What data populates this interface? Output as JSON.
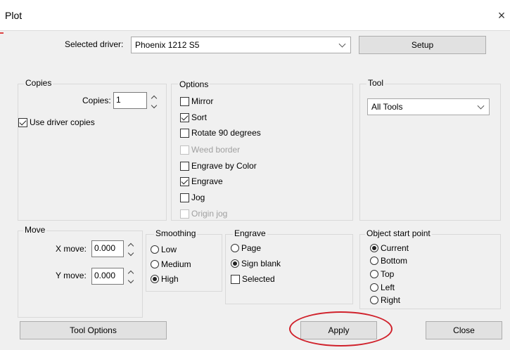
{
  "window": {
    "title": "Plot",
    "close_glyph": "×"
  },
  "driver": {
    "label": "Selected driver:",
    "value": "Phoenix 1212 S5",
    "setup_label": "Setup"
  },
  "copies": {
    "group_title": "Copies",
    "label": "Copies:",
    "value": "1",
    "use_driver_copies": "Use driver copies",
    "use_driver_copies_checked": true
  },
  "options": {
    "group_title": "Options",
    "items": [
      {
        "label": "Mirror",
        "checked": false,
        "enabled": true
      },
      {
        "label": "Sort",
        "checked": true,
        "enabled": true
      },
      {
        "label": "Rotate 90 degrees",
        "checked": false,
        "enabled": true
      },
      {
        "label": "Weed border",
        "checked": false,
        "enabled": false
      },
      {
        "label": "Engrave by Color",
        "checked": false,
        "enabled": true
      },
      {
        "label": "Engrave",
        "checked": true,
        "enabled": true
      },
      {
        "label": "Jog",
        "checked": false,
        "enabled": true
      },
      {
        "label": "Origin jog",
        "checked": false,
        "enabled": false
      }
    ]
  },
  "tool": {
    "group_title": "Tool",
    "value": "All Tools"
  },
  "move": {
    "group_title": "Move",
    "x_label": "X move:",
    "x_value": "0.000",
    "y_label": "Y move:",
    "y_value": "0.000"
  },
  "smoothing": {
    "group_title": "Smoothing",
    "items": [
      {
        "label": "Low",
        "selected": false
      },
      {
        "label": "Medium",
        "selected": false
      },
      {
        "label": "High",
        "selected": true
      }
    ]
  },
  "engrave": {
    "group_title": "Engrave",
    "items": [
      {
        "label": "Page",
        "selected": false
      },
      {
        "label": "Sign blank",
        "selected": true
      }
    ],
    "selected_checkbox": {
      "label": "Selected",
      "checked": false
    }
  },
  "object_start": {
    "group_title": "Object start point",
    "items": [
      {
        "label": "Current",
        "selected": true
      },
      {
        "label": "Bottom",
        "selected": false
      },
      {
        "label": "Top",
        "selected": false
      },
      {
        "label": "Left",
        "selected": false
      },
      {
        "label": "Right",
        "selected": false
      }
    ]
  },
  "buttons": {
    "tool_options": "Tool Options",
    "apply": "Apply",
    "close": "Close"
  },
  "annotation": {
    "highlight_color": "#d0212b"
  }
}
